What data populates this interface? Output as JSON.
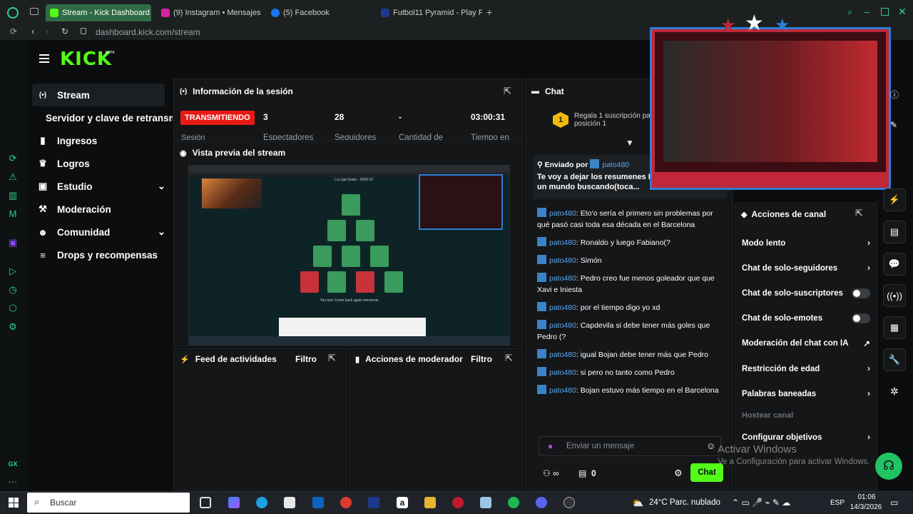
{
  "browser": {
    "tabs": [
      {
        "title": "Stream - Kick Dashboard",
        "active": true
      },
      {
        "title": "(9) Instagram • Mensajes"
      },
      {
        "title": "(5) Facebook"
      },
      {
        "title": "Futbol11 Pyramid - Play Fo"
      }
    ],
    "url": "dashboard.kick.com/stream"
  },
  "kick": {
    "logo": "KICK",
    "beta": "BETA",
    "nav": [
      {
        "label": "Stream",
        "icon": "broadcast-icon",
        "glyph": "(•)"
      },
      {
        "label": "Servidor y clave de retransm",
        "icon": "",
        "glyph": ""
      },
      {
        "label": "Ingresos",
        "icon": "chart-icon",
        "glyph": "▮"
      },
      {
        "label": "Logros",
        "icon": "trophy-icon",
        "glyph": "🏆"
      },
      {
        "label": "Estudio",
        "icon": "studio-icon",
        "glyph": "▣",
        "chevron": true
      },
      {
        "label": "Moderación",
        "icon": "hammer-icon",
        "glyph": "⚒"
      },
      {
        "label": "Comunidad",
        "icon": "people-icon",
        "glyph": "👥",
        "chevron": true
      },
      {
        "label": "Drops y recompensas",
        "icon": "drops-icon",
        "glyph": "≡"
      }
    ]
  },
  "session": {
    "title": "Información de la sesión",
    "status": "TRANSMITIENDO",
    "session_label": "Sesión",
    "stats": [
      {
        "value": "3",
        "label": "Espectadores"
      },
      {
        "value": "28",
        "label": "Seguidores"
      },
      {
        "value": "-",
        "label": "Cantidad de"
      },
      {
        "value": "03:00:31",
        "label": "Tiempo en"
      }
    ]
  },
  "preview": {
    "title": "Vista previa del stream",
    "game_title": "La Liga Goals - 2009-10",
    "footer": "You lost. Come back again tomorrow."
  },
  "feed": {
    "title": "Feed de actividades",
    "filter": "Filtro"
  },
  "modactions": {
    "title": "Acciones de moderador",
    "filter": "Filtro"
  },
  "chat": {
    "title": "Chat",
    "gift_rank": "1",
    "gift_text": "Regala 1 suscripción para posición 1",
    "pinned_label": "Enviado por",
    "pinned_user": "pato480",
    "pinned_text": "Te voy a dejar los resumenes Lig por qué tardas un mundo buscando(toca...",
    "messages": [
      {
        "user": "pato480",
        "text": ": Eto'o sería el primero sin problemas por qué pasó casi toda esa década en el Barcelona"
      },
      {
        "user": "pato480",
        "text": ": Ronaldo y luego Fabiano(?"
      },
      {
        "user": "pato480",
        "text": ": Simón"
      },
      {
        "user": "pato480",
        "text": ": Pedro creo fue menos goleador que que Xavi e Iniesta"
      },
      {
        "user": "pato480",
        "text": ": por el tiempo digo yo xd"
      },
      {
        "user": "pato480",
        "text": ": Capdevila si debe tener más goles que Pedro (?"
      },
      {
        "user": "pato480",
        "text": ": igual Bojan debe tener más que Pedro"
      },
      {
        "user": "pato480",
        "text": ": si pero no tanto como Pedro"
      },
      {
        "user": "pato480",
        "text": ": Bojan estuvo más tiempo en el Barcelona"
      }
    ],
    "placeholder": "Enviar un mensaje",
    "points": "0",
    "send": "Chat"
  },
  "channel_actions": {
    "title": "Acciones de canal",
    "items": [
      {
        "label": "Modo lento",
        "type": "chevron"
      },
      {
        "label": "Chat de solo-seguidores",
        "type": "chevron"
      },
      {
        "label": "Chat de solo-suscriptores",
        "type": "toggle"
      },
      {
        "label": "Chat de solo-emotes",
        "type": "toggle"
      },
      {
        "label": "Moderación del chat con IA",
        "type": "external"
      },
      {
        "label": "Restricción de edad",
        "type": "chevron"
      },
      {
        "label": "Palabras baneadas",
        "type": "chevron"
      },
      {
        "label": "Hostear canal",
        "type": "disabled"
      },
      {
        "label": "Configurar objetivos",
        "type": "chevron"
      }
    ]
  },
  "watermark": {
    "line1": "Activar Windows",
    "line2": "Ve a Configuración para activar Windows."
  },
  "taskbar": {
    "search": "Buscar",
    "weather": "24°C  Parc. nublado",
    "lang": "ESP",
    "time": "01:06",
    "date": "14/3/2026"
  },
  "colors": {
    "accent": "#53fc18",
    "live": "#e91916",
    "user": "#5aa9ef"
  }
}
